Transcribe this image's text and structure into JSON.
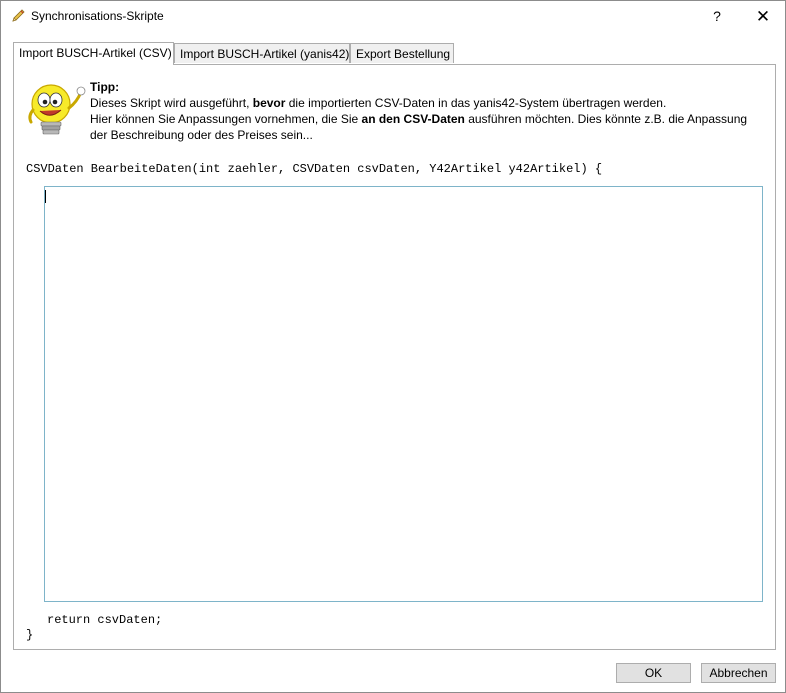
{
  "window": {
    "title": "Synchronisations-Skripte",
    "help_label": "?",
    "close_label": "✕"
  },
  "tabs": [
    {
      "label": "Import BUSCH-Artikel (CSV)",
      "active": true
    },
    {
      "label": "Import BUSCH-Artikel (yanis42)",
      "active": false
    },
    {
      "label": "Export Bestellung",
      "active": false
    }
  ],
  "tip": {
    "title": "Tipp:",
    "line1_a": "Dieses Skript wird ausgeführt, ",
    "line1_b": "bevor",
    "line1_c": " die importierten CSV-Daten in das yanis42-System übertragen werden.",
    "line2_a": "Hier können Sie Anpassungen vornehmen, die Sie ",
    "line2_b": "an den CSV-Daten",
    "line2_c": " ausführen möchten. Dies könnte z.B. die Anpassung",
    "line3": "der Beschreibung oder des Preises sein..."
  },
  "code": {
    "signature": "CSVDaten BearbeiteDaten(int zaehler, CSVDaten csvDaten, Y42Artikel y42Artikel) {",
    "editor_value": "",
    "return_line": "return csvDaten;",
    "closing_brace": "}"
  },
  "buttons": {
    "ok": "OK",
    "cancel": "Abbrechen"
  },
  "icons": {
    "window_icon": "pencil-icon",
    "tip_icon": "lightbulb-mascot-icon"
  }
}
